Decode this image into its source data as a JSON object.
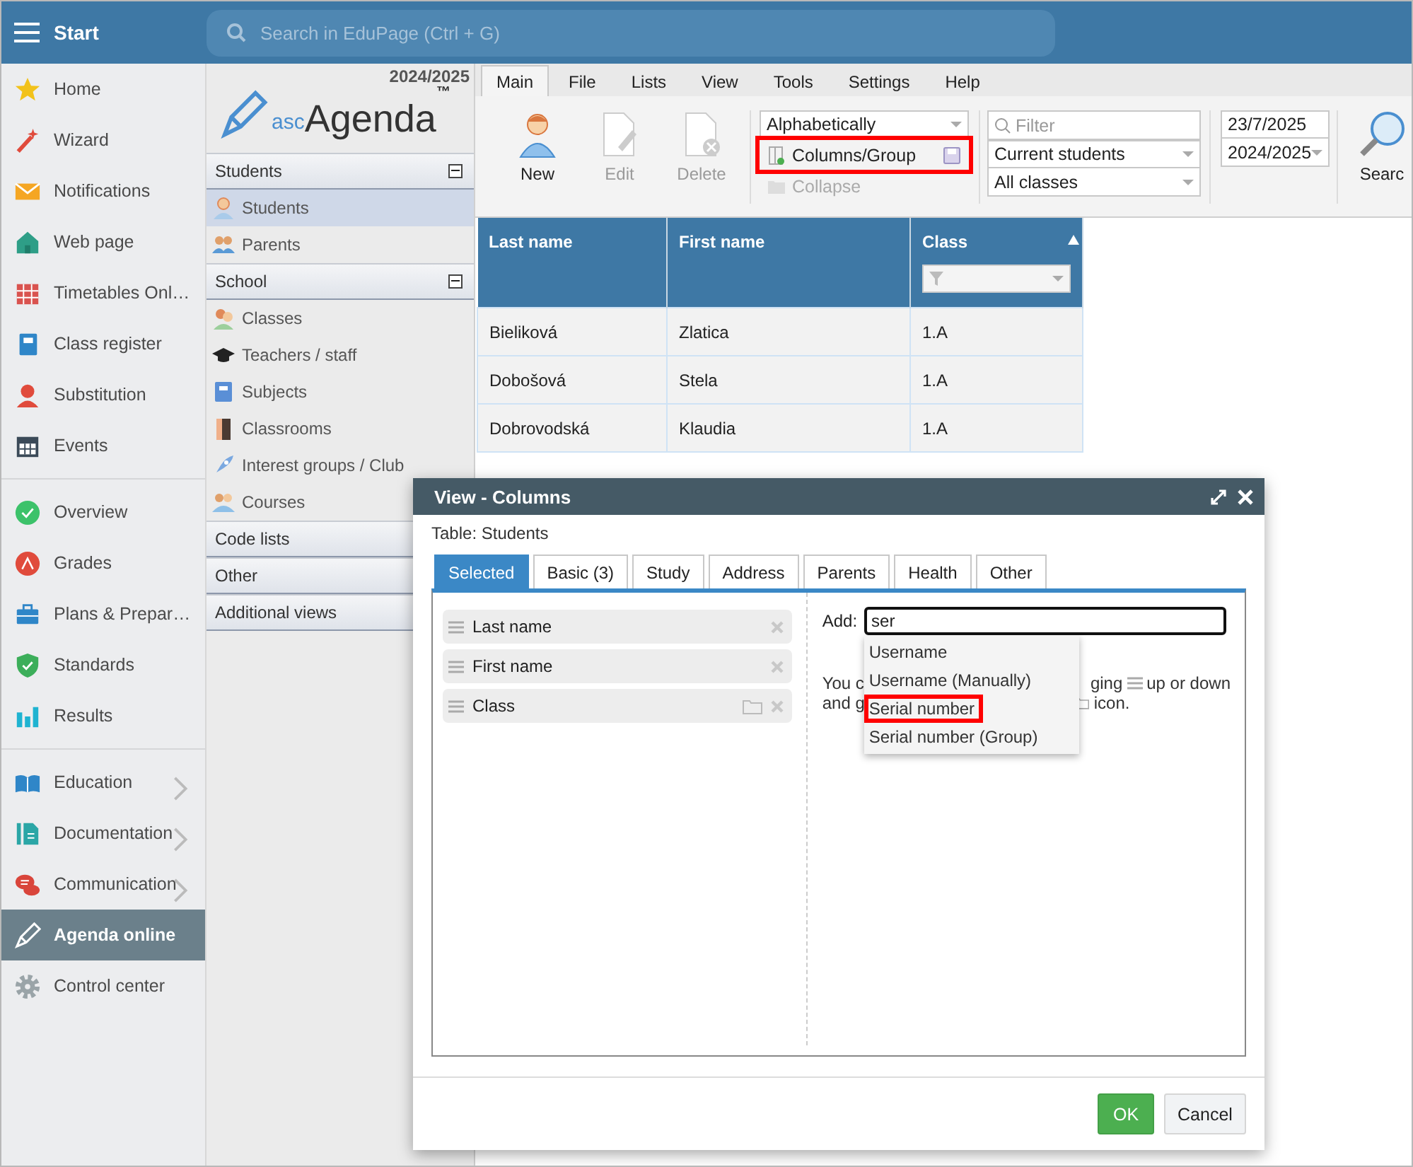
{
  "topbar": {
    "menu_label": "Start",
    "search_placeholder": "Search in EduPage (Ctrl + G)"
  },
  "sidebar": {
    "groups": [
      {
        "items": [
          {
            "label": "Home",
            "selected": false,
            "expandable": false
          },
          {
            "label": "Wizard",
            "selected": false,
            "expandable": false
          },
          {
            "label": "Notifications",
            "selected": false,
            "expandable": false
          },
          {
            "label": "Web page",
            "selected": false,
            "expandable": false
          },
          {
            "label": "Timetables Onl…",
            "selected": false,
            "expandable": false
          },
          {
            "label": "Class register",
            "selected": false,
            "expandable": false
          },
          {
            "label": "Substitution",
            "selected": false,
            "expandable": false
          },
          {
            "label": "Events",
            "selected": false,
            "expandable": false
          }
        ]
      },
      {
        "items": [
          {
            "label": "Overview",
            "selected": false,
            "expandable": false
          },
          {
            "label": "Grades",
            "selected": false,
            "expandable": false
          },
          {
            "label": "Plans & Prepar…",
            "selected": false,
            "expandable": false
          },
          {
            "label": "Standards",
            "selected": false,
            "expandable": false
          },
          {
            "label": "Results",
            "selected": false,
            "expandable": false
          }
        ]
      },
      {
        "items": [
          {
            "label": "Education",
            "selected": false,
            "expandable": true
          },
          {
            "label": "Documentation",
            "selected": false,
            "expandable": true
          },
          {
            "label": "Communication",
            "selected": false,
            "expandable": true
          },
          {
            "label": "Agenda online",
            "selected": true,
            "expandable": false
          },
          {
            "label": "Control center",
            "selected": false,
            "expandable": false
          }
        ]
      }
    ]
  },
  "app_panel": {
    "year": "2024/2025",
    "logo": {
      "prefix": "asc",
      "name": "Agenda",
      "mark": "™"
    },
    "sections": [
      {
        "title": "Students",
        "expanded": true,
        "items": [
          {
            "label": "Students",
            "selected": true
          },
          {
            "label": "Parents",
            "selected": false
          }
        ]
      },
      {
        "title": "School",
        "expanded": true,
        "items": [
          {
            "label": "Classes",
            "selected": false
          },
          {
            "label": "Teachers / staff",
            "selected": false
          },
          {
            "label": "Subjects",
            "selected": false
          },
          {
            "label": "Classrooms",
            "selected": false
          },
          {
            "label": "Interest groups / Club",
            "selected": false
          },
          {
            "label": "Courses",
            "selected": false
          }
        ]
      },
      {
        "title": "Code lists",
        "expanded": false
      },
      {
        "title": "Other",
        "expanded": false
      },
      {
        "title": "Additional views",
        "expanded": false
      }
    ]
  },
  "ribbon": {
    "tabs": [
      {
        "label": "Main",
        "selected": true
      },
      {
        "label": "File",
        "selected": false
      },
      {
        "label": "Lists",
        "selected": false
      },
      {
        "label": "View",
        "selected": false
      },
      {
        "label": "Tools",
        "selected": false
      },
      {
        "label": "Settings",
        "selected": false
      },
      {
        "label": "Help",
        "selected": false
      }
    ],
    "buttons": [
      {
        "label": "New",
        "disabled": false
      },
      {
        "label": "Edit",
        "disabled": true
      },
      {
        "label": "Delete",
        "disabled": true
      }
    ],
    "sort": "Alphabetically",
    "columns_group": {
      "label": "Columns/Group",
      "highlighted": true
    },
    "collapse": {
      "label": "Collapse",
      "disabled": true
    },
    "filter": {
      "placeholder": "Filter"
    },
    "status_filter": "Current students",
    "class_filter": "All classes",
    "date": "23/7/2025",
    "school_year": "2024/2025",
    "search_button": "Searc"
  },
  "table": {
    "columns": [
      {
        "label": "Last name",
        "sorted_ascending": false,
        "has_filter": false
      },
      {
        "label": "First name",
        "sorted_ascending": false,
        "has_filter": false
      },
      {
        "label": "Class",
        "sorted_ascending": true,
        "has_filter": true
      }
    ],
    "rows": [
      [
        "Bieliková",
        "Zlatica",
        "1.A"
      ],
      [
        "Dobošová",
        "Stela",
        "1.A"
      ],
      [
        "Dobrovodská",
        "Klaudia",
        "1.A"
      ]
    ]
  },
  "dialog": {
    "title": "View - Columns",
    "table_label": "Table: Students",
    "tabs": [
      {
        "label": "Selected",
        "selected": true
      },
      {
        "label": "Basic (3)",
        "selected": false
      },
      {
        "label": "Study",
        "selected": false
      },
      {
        "label": "Address",
        "selected": false
      },
      {
        "label": "Parents",
        "selected": false
      },
      {
        "label": "Health",
        "selected": false
      },
      {
        "label": "Other",
        "selected": false
      }
    ],
    "selected_columns": [
      {
        "label": "Last name",
        "groupable": false
      },
      {
        "label": "First name",
        "groupable": false
      },
      {
        "label": "Class",
        "groupable": true
      }
    ],
    "add_label": "Add:",
    "add_value": "ser",
    "suggestions": [
      {
        "label": "Username",
        "highlighted": false
      },
      {
        "label": "Username (Manually)",
        "highlighted": false
      },
      {
        "label": "Serial number",
        "highlighted": true
      },
      {
        "label": "Serial number (Group)",
        "highlighted": false
      }
    ],
    "hint_lines": [
      [
        {
          "kind": "text",
          "text": "You c"
        },
        {
          "kind": "covered"
        },
        {
          "kind": "text",
          "text": "ging"
        },
        {
          "kind": "drag_icon"
        },
        {
          "kind": "text",
          "text": "up or down"
        }
      ],
      [
        {
          "kind": "text",
          "text": "and g"
        },
        {
          "kind": "covered"
        },
        {
          "kind": "folder_icon"
        },
        {
          "kind": "text",
          "text": "icon."
        }
      ]
    ],
    "ok": "OK",
    "cancel": "Cancel"
  }
}
